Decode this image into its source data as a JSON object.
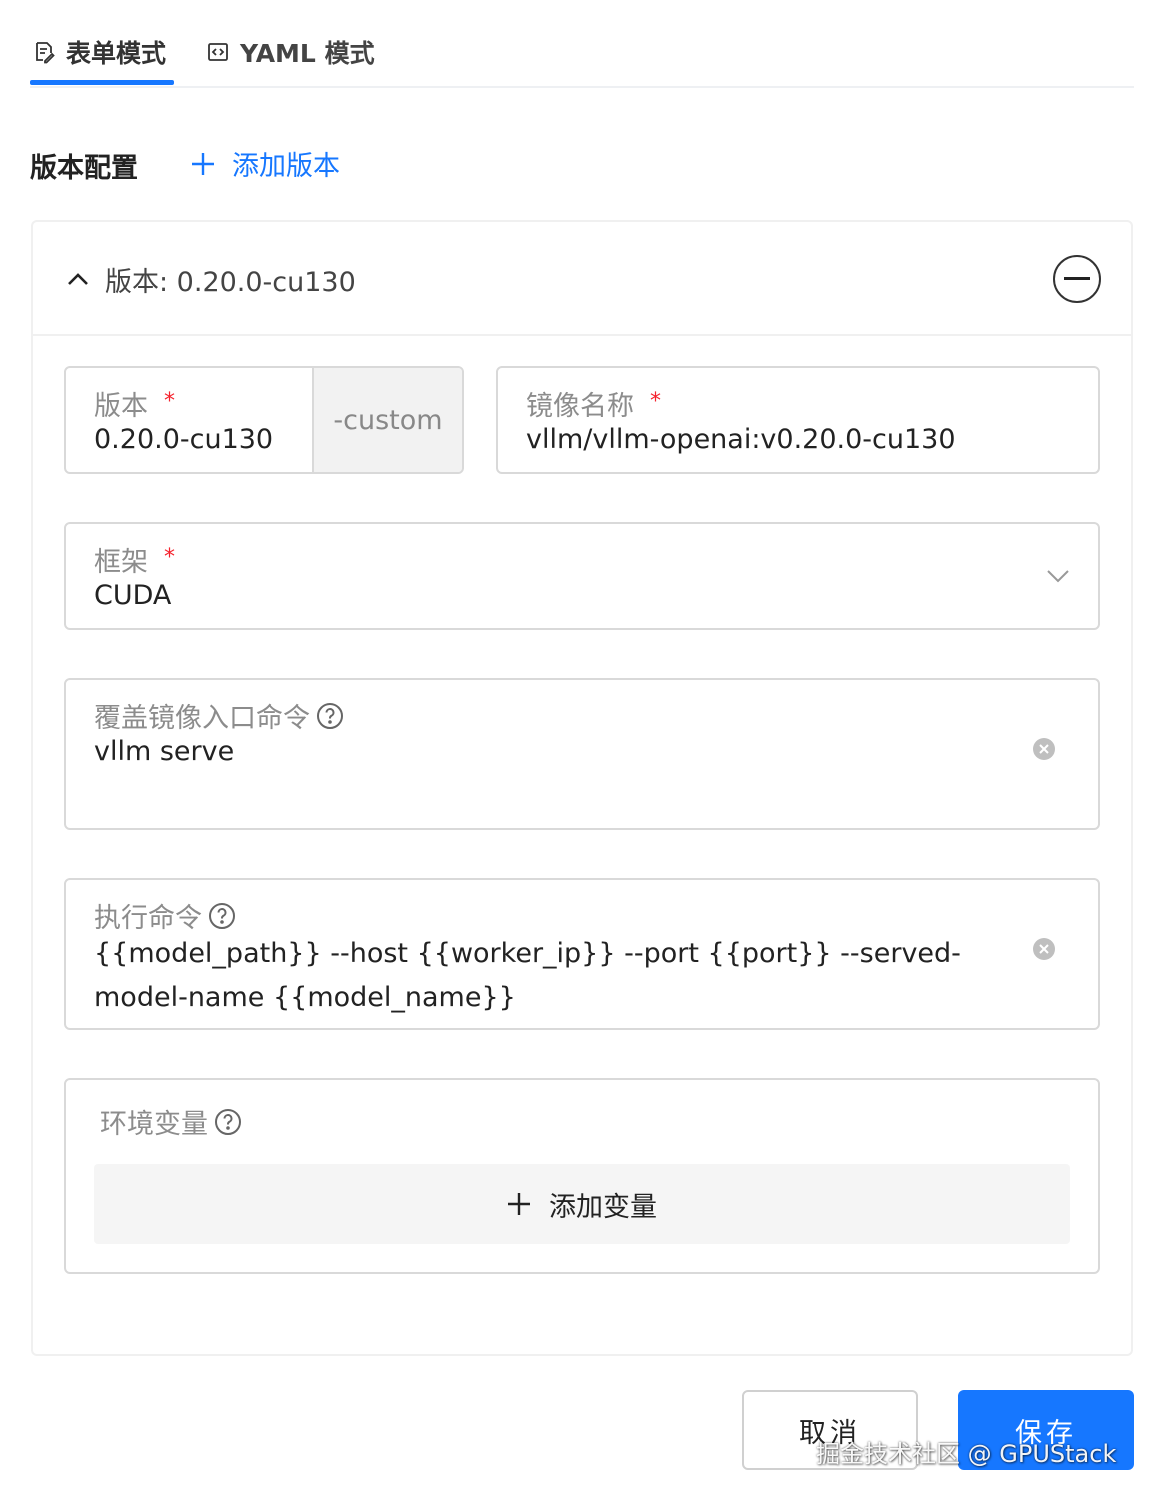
{
  "tabs": [
    {
      "label": "表单模式",
      "icon": "form-icon",
      "active": true
    },
    {
      "label": "YAML 模式",
      "icon": "code-icon",
      "active": false
    }
  ],
  "section": {
    "title": "版本配置",
    "add_version_label": "添加版本"
  },
  "version_card": {
    "title": "版本: 0.20.0-cu130",
    "fields": {
      "version": {
        "label": "版本",
        "required_mark": "*",
        "value": "0.20.0-cu130",
        "suffix": "-custom"
      },
      "image": {
        "label": "镜像名称",
        "required_mark": "*",
        "value": "vllm/vllm-openai:v0.20.0-cu130"
      },
      "framework": {
        "label": "框架",
        "required_mark": "*",
        "value": "CUDA"
      },
      "entrypoint": {
        "label": "覆盖镜像入口命令",
        "value": "vllm serve"
      },
      "exec_command": {
        "label": "执行命令",
        "value": "{{model_path}} --host {{worker_ip}} --port {{port}} --served-model-name {{model_name}}"
      },
      "env_vars": {
        "label": "环境变量",
        "add_label": "添加变量"
      }
    }
  },
  "footer": {
    "cancel_label": "取消",
    "save_label": "保存"
  },
  "watermark": "掘金技术社区 @ GPUStack",
  "colors": {
    "accent": "#1677ff",
    "required": "#f5222d",
    "border": "#d9d9d9"
  }
}
